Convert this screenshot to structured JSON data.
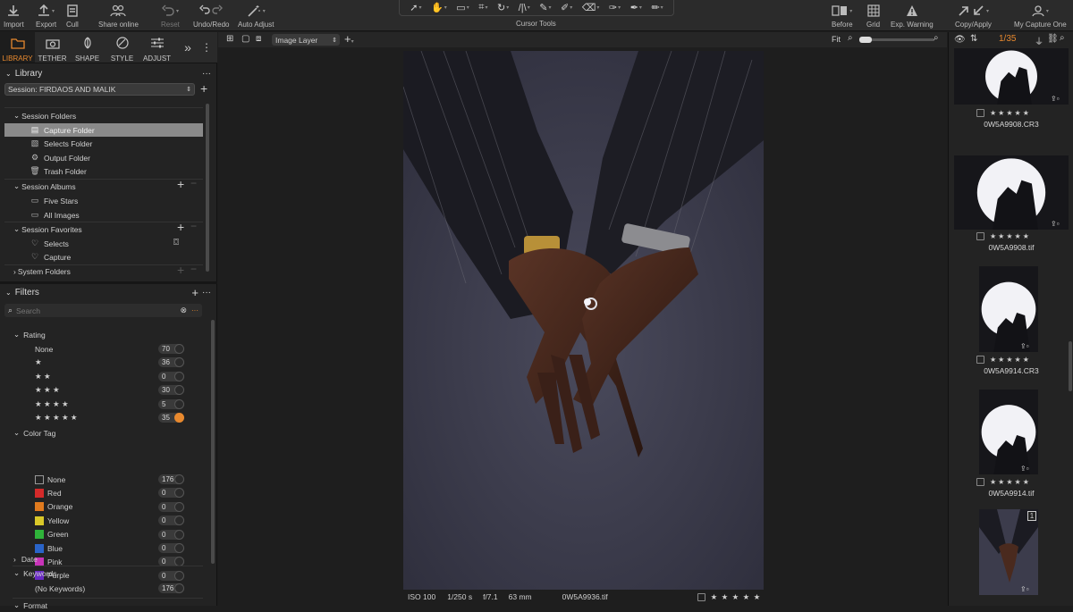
{
  "toolbar": {
    "import": "Import",
    "export": "Export",
    "cull": "Cull",
    "share_online": "Share online",
    "reset": "Reset",
    "undo_redo": "Undo/Redo",
    "auto_adjust": "Auto Adjust",
    "cursor_tools": "Cursor Tools",
    "before": "Before",
    "grid": "Grid",
    "exp_warning": "Exp. Warning",
    "copy_apply": "Copy/Apply",
    "my_capture_one": "My Capture One"
  },
  "tool_tabs": [
    {
      "label": "LIBRARY",
      "icon": "folder-icon"
    },
    {
      "label": "TETHER",
      "icon": "camera-icon"
    },
    {
      "label": "SHAPE",
      "icon": "shape-icon"
    },
    {
      "label": "STYLE",
      "icon": "style-icon"
    },
    {
      "label": "ADJUST",
      "icon": "sliders-icon"
    }
  ],
  "library": {
    "title": "Library",
    "session": "Session: FIRDAOS AND MALIK",
    "session_folders": "Session Folders",
    "folders": [
      "Capture Folder",
      "Selects Folder",
      "Output Folder",
      "Trash Folder"
    ],
    "session_albums": "Session Albums",
    "albums": [
      "Five Stars",
      "All Images"
    ],
    "session_favorites": "Session Favorites",
    "favorites": [
      "Selects",
      "Capture"
    ],
    "system_folders": "System Folders"
  },
  "filters": {
    "title": "Filters",
    "search_placeholder": "Search",
    "rating": "Rating",
    "ratings": [
      {
        "label": "None",
        "count": "70"
      },
      {
        "label": "★",
        "count": "36"
      },
      {
        "label": "★ ★",
        "count": "0"
      },
      {
        "label": "★ ★ ★",
        "count": "30"
      },
      {
        "label": "★ ★ ★ ★",
        "count": "5"
      },
      {
        "label": "★ ★ ★ ★ ★",
        "count": "35"
      }
    ],
    "color_tag": "Color Tag",
    "colors": [
      {
        "label": "None",
        "count": "176",
        "color": "none"
      },
      {
        "label": "Red",
        "count": "0",
        "color": "#d42a2a"
      },
      {
        "label": "Orange",
        "count": "0",
        "color": "#e07a1e"
      },
      {
        "label": "Yellow",
        "count": "0",
        "color": "#d9c829"
      },
      {
        "label": "Green",
        "count": "0",
        "color": "#2fb33a"
      },
      {
        "label": "Blue",
        "count": "0",
        "color": "#2a64c9"
      },
      {
        "label": "Pink",
        "count": "0",
        "color": "#c833b8"
      },
      {
        "label": "Purple",
        "count": "0",
        "color": "#6a2bc4"
      }
    ],
    "date": "Date",
    "keywords": "Keywords",
    "no_keywords": "(No Keywords)",
    "no_keywords_count": "176",
    "format": "Format"
  },
  "viewer": {
    "layer": "Image Layer",
    "zoom": "Fit",
    "iso": "ISO 100",
    "shutter": "1/250 s",
    "aperture": "f/7.1",
    "focal": "63 mm",
    "filename": "0W5A9936.tif",
    "stars": "★ ★ ★ ★ ★"
  },
  "browser": {
    "counter": "1/35",
    "thumbs": [
      {
        "name": "0W5A9908.CR3",
        "stars": "★★★★★"
      },
      {
        "name": "0W5A9908.tif",
        "stars": "★★★★★"
      },
      {
        "name": "0W5A9914.CR3",
        "stars": "★★★★★"
      },
      {
        "name": "0W5A9914.tif",
        "stars": "★★★★★"
      },
      {
        "name": "",
        "stars": "",
        "badge": "1"
      }
    ]
  },
  "colors": {
    "accent": "#e8892e",
    "panel": "#232323",
    "toolbar": "#2b2b2b"
  }
}
